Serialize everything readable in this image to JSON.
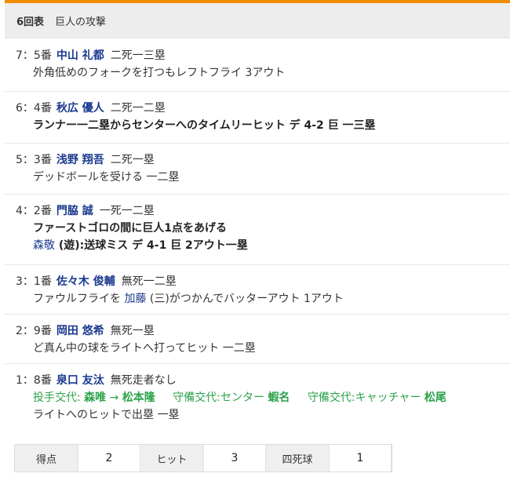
{
  "header": {
    "inning": "6回表",
    "side": "巨人の攻撃"
  },
  "plays": [
    {
      "order": "7：5番",
      "player": "中山 礼都",
      "runners": "二死一三塁",
      "desc": [
        "外角低めのフォークを打つもレフトフライ 3アウト"
      ]
    },
    {
      "order": "6：4番",
      "player": "秋広 優人",
      "runners": "二死一二塁",
      "desc": [
        "ランナー一二塁からセンターへのタイムリーヒット デ 4-2 巨 一三塁"
      ]
    },
    {
      "order": "5：3番",
      "player": "浅野 翔吾",
      "runners": "二死一塁",
      "desc": [
        "デッドボールを受ける 一二塁"
      ]
    },
    {
      "order": "4：2番",
      "player": "門脇 誠",
      "runners": "一死一二塁",
      "desc": [
        "ファーストゴロの間に巨人1点をあげる"
      ],
      "error_player": "森敬",
      "error_text": " (遊):送球ミス デ 4-1 巨 2アウト一塁"
    },
    {
      "order": "3：1番",
      "player": "佐々木 俊輔",
      "runners": "無死一二塁",
      "fielder_pre": "ファウルフライを ",
      "fielder": "加藤",
      "fielder_post": " (三)がつかんでバッターアウト 1アウト"
    },
    {
      "order": "2：9番",
      "player": "岡田 悠希",
      "runners": "無死一塁",
      "desc": [
        "ど真ん中の球をライトへ打ってヒット 一二塁"
      ]
    },
    {
      "order": "1：8番",
      "player": "泉口 友汰",
      "runners": "無死走者なし",
      "sub1_label": "投手交代: ",
      "sub1_from": "森唯",
      "sub1_arrow": " → ",
      "sub1_to": "松本隆",
      "sub2_label": "守備交代:センター ",
      "sub2_name": "蝦名",
      "sub3_label": "守備交代:キャッチャー ",
      "sub3_name": "松尾",
      "desc": [
        "ライトへのヒットで出塁 一塁"
      ]
    }
  ],
  "stats": [
    {
      "label": "得点",
      "value": "2"
    },
    {
      "label": "ヒット",
      "value": "3"
    },
    {
      "label": "四死球",
      "value": "1"
    }
  ],
  "colors": {
    "accent": "#f08c00",
    "player": "#1a3a8f",
    "substitution": "#2aa24a"
  }
}
